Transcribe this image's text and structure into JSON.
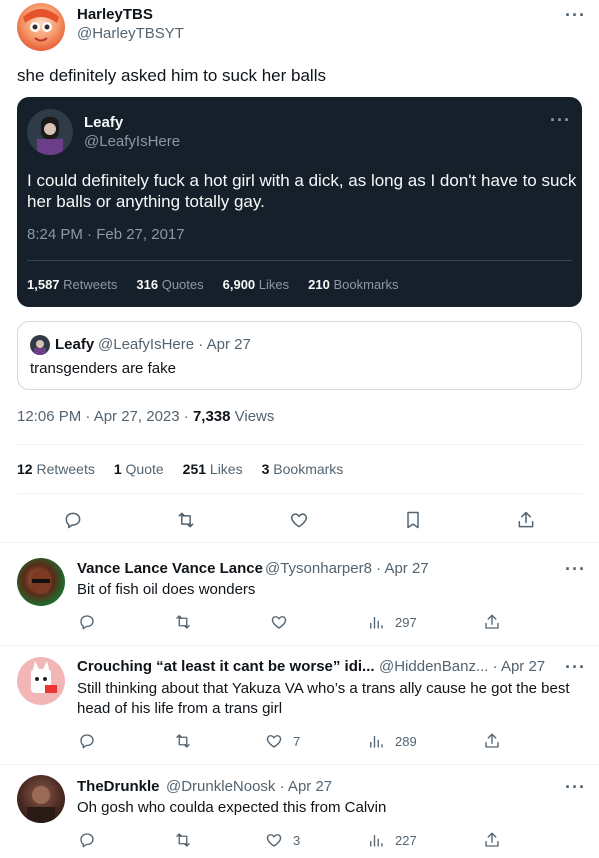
{
  "main": {
    "author_name": "HarleyTBS",
    "author_handle": "@HarleyTBSYT",
    "more": "···",
    "text": "she definitely asked him to suck her balls",
    "quoted_dark": {
      "name": "Leafy",
      "handle": "@LeafyIsHere",
      "text": "I could definitely fuck a hot girl with a dick, as long as I don't have to suck her balls or anything totally gay.",
      "timestamp": "8:24 PM · Feb 27, 2017",
      "stats": [
        {
          "num": "1,587",
          "label": "Retweets"
        },
        {
          "num": "316",
          "label": "Quotes"
        },
        {
          "num": "6,900",
          "label": "Likes"
        },
        {
          "num": "210",
          "label": "Bookmarks"
        }
      ]
    },
    "quoted_light": {
      "name": "Leafy",
      "meta": "@LeafyIsHere · Apr 27",
      "text": "transgenders are fake"
    },
    "timestamp": "12:06 PM · Apr 27, 2023 · ",
    "views_num": "7,338",
    "views_label": " Views",
    "stats": [
      {
        "num": "12",
        "label": "Retweets"
      },
      {
        "num": "1",
        "label": "Quote"
      },
      {
        "num": "251",
        "label": "Likes"
      },
      {
        "num": "3",
        "label": "Bookmarks"
      }
    ]
  },
  "replies": [
    {
      "name": "Vance Lance Vance Lance",
      "meta": "@Tysonharper8 · Apr 27",
      "text": "Bit of fish oil does wonders",
      "like_count": "",
      "views": "297"
    },
    {
      "name": "Crouching “at least it cant be worse” idi...",
      "meta": "@HiddenBanz... · Apr 27",
      "text": "Still thinking about that Yakuza VA who’s a trans ally cause he got the best head of his life from a trans girl",
      "like_count": "7",
      "views": "289"
    },
    {
      "name": "TheDrunkle",
      "meta": "@DrunkleNoosk · Apr 27",
      "text": "Oh gosh who coulda expected this from Calvin",
      "like_count": "3",
      "views": "227"
    }
  ],
  "colors": {
    "text": "#0f1419",
    "muted": "#536471",
    "dark_card": "#15202b",
    "dark_text": "#f7f9f9",
    "dark_muted": "#8b98a5",
    "divider": "#eff3f4"
  },
  "icons": [
    "reply-icon",
    "retweet-icon",
    "like-icon",
    "bookmark-icon",
    "share-icon",
    "views-icon",
    "more-icon"
  ]
}
